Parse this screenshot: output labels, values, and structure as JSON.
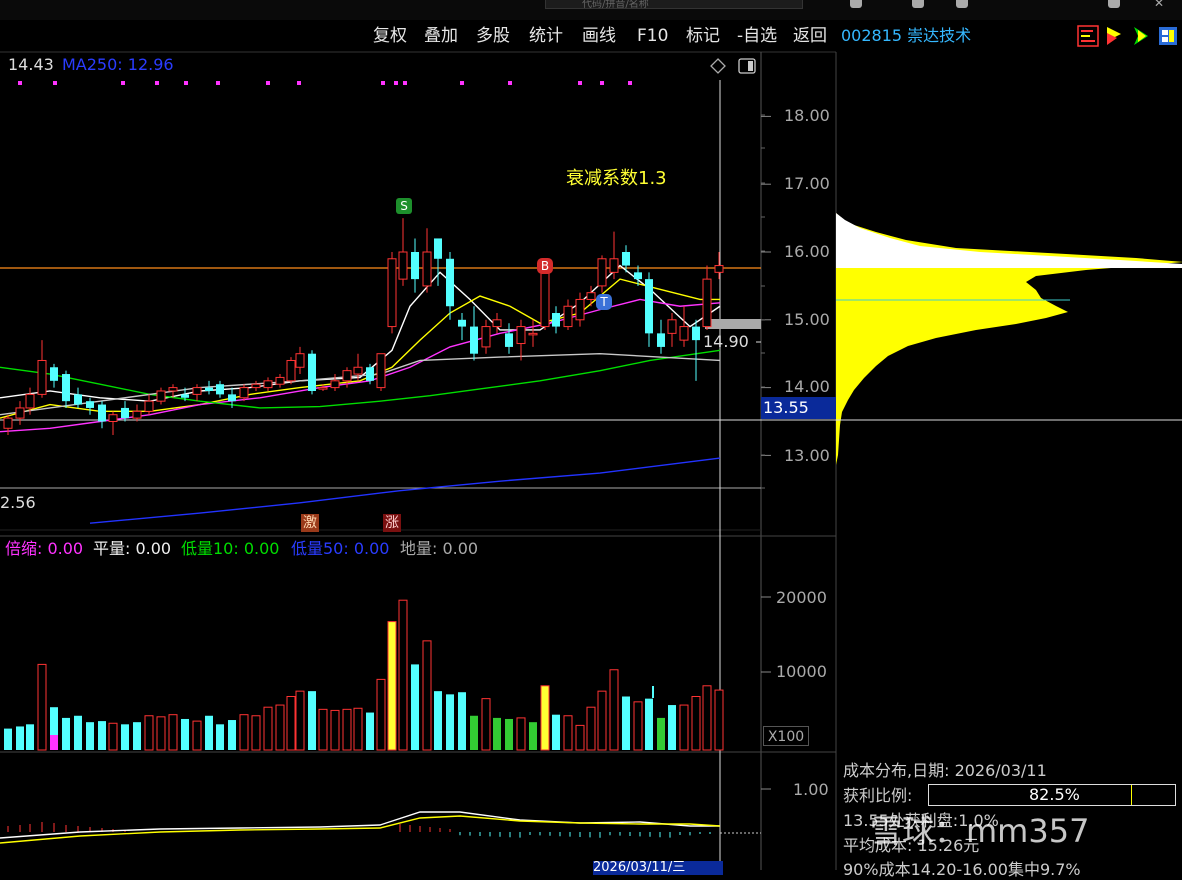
{
  "search": {
    "placeholder": "代码/拼音/名称"
  },
  "toolbar": {
    "items": [
      "复权",
      "叠加",
      "多股",
      "统计",
      "画线",
      "F10",
      "标记",
      "-自选",
      "返回"
    ]
  },
  "stock": {
    "code_name": "002815 崇达技术"
  },
  "ma_legend": {
    "ma_prefix": "14.43",
    "ma250": "MA250: 12.96"
  },
  "annotation": {
    "decay": "衰减系数1.3"
  },
  "signals": {
    "s": "S",
    "b": "B",
    "t": "T"
  },
  "markers": {
    "ji": "激",
    "zhang": "涨"
  },
  "price_axis": {
    "ticks": [
      "18.00",
      "17.00",
      "16.00",
      "15.00",
      "14.00",
      "13.00"
    ],
    "cursor_price": "13.55",
    "crosshair_label": "14.90",
    "low_label": "2.56"
  },
  "volume_legend": {
    "beisuo": "倍缩: 0.00",
    "pingliang": "平量: 0.00",
    "diliang10": "低量10: 0.00",
    "diliang50": "低量50: 0.00",
    "diliang": "地量: 0.00"
  },
  "volume_axis": {
    "ticks": [
      "20000",
      "10000"
    ],
    "unit": "X100"
  },
  "macd_axis": {
    "ticks": [
      "1.00"
    ]
  },
  "cost_panel": {
    "title": "成本分布,日期: 2026/03/11",
    "profit_label": "获利比例:",
    "profit_value": "82.5%",
    "profit_ratio": 0.825,
    "line3": "13.55处获利盘:1.0%",
    "line4": "平均成本: 15.26元",
    "line5": "90%成本14.20-16.00集中9.7%"
  },
  "date_label": "2026/03/11/三",
  "watermark": "雪球：mm357",
  "colors": {
    "up": "#ff3333",
    "down": "#54ffff",
    "ma_white": "#ffffff",
    "ma_yellow": "#ffff00",
    "ma_magenta": "#ff33ff",
    "ma_green": "#00dd00",
    "ma250": "#2233ff",
    "code": "#35b8ff"
  }
}
